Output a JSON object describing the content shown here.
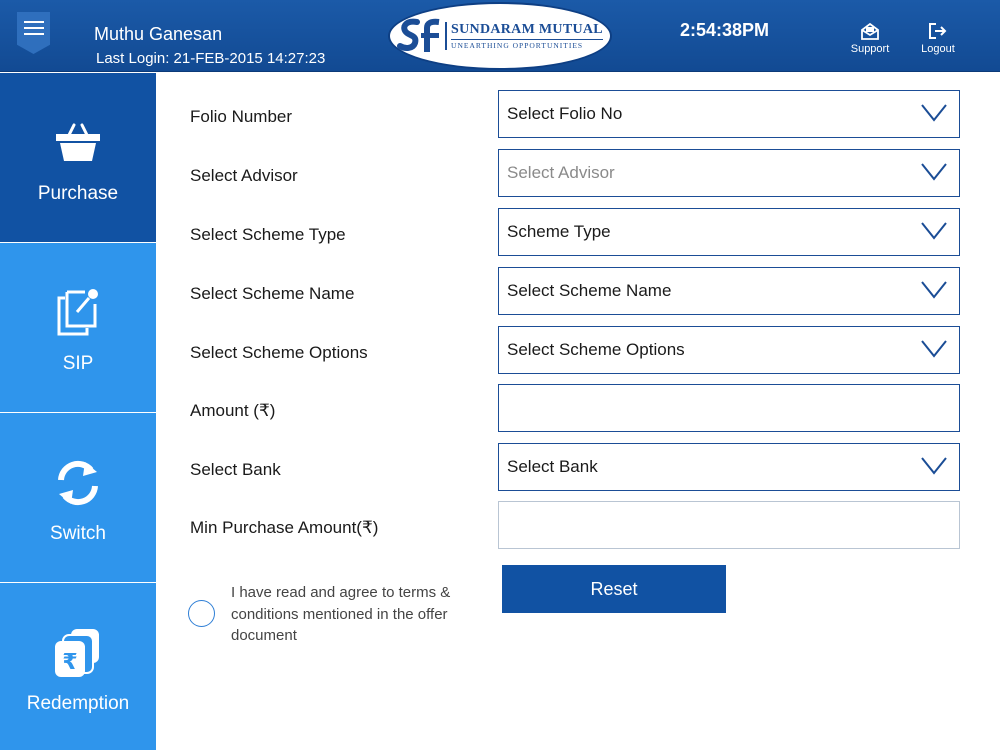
{
  "header": {
    "user_name": "Muthu Ganesan",
    "last_login": "Last Login: 21-FEB-2015 14:27:23",
    "logo_title": "SUNDARAM MUTUAL",
    "logo_tagline": "UNEARTHING OPPORTUNITIES",
    "time": "2:54:38PM",
    "support_label": "Support",
    "logout_label": "Logout"
  },
  "sidebar": {
    "items": [
      {
        "label": "Purchase",
        "icon": "basket-icon",
        "active": true
      },
      {
        "label": "SIP",
        "icon": "sip-copy-icon",
        "active": false
      },
      {
        "label": "Switch",
        "icon": "switch-arrows-icon",
        "active": false
      },
      {
        "label": "Redemption",
        "icon": "rupee-cards-icon",
        "active": false
      }
    ]
  },
  "form": {
    "fields": [
      {
        "label": "Folio Number",
        "value": "Select Folio No",
        "type": "select"
      },
      {
        "label": "Select Advisor",
        "value": "Select Advisor",
        "type": "select",
        "placeholder": true
      },
      {
        "label": "Select Scheme Type",
        "value": "Scheme Type",
        "type": "select"
      },
      {
        "label": "Select Scheme Name",
        "value": "Select Scheme Name",
        "type": "select"
      },
      {
        "label": "Select Scheme Options",
        "value": "Select Scheme Options",
        "type": "select"
      },
      {
        "label": "Amount (₹)",
        "value": "",
        "type": "input"
      },
      {
        "label": "Select Bank",
        "value": "Select Bank",
        "type": "select"
      },
      {
        "label": "Min Purchase Amount(₹)",
        "value": "",
        "type": "input"
      }
    ],
    "terms_text": "I have read and agree to terms & conditions mentioned in the offer document",
    "reset_label": "Reset"
  },
  "colors": {
    "header": "#124a93",
    "active_nav": "#1152a3",
    "nav": "#2f95ec",
    "field_border": "#1b4d96"
  }
}
